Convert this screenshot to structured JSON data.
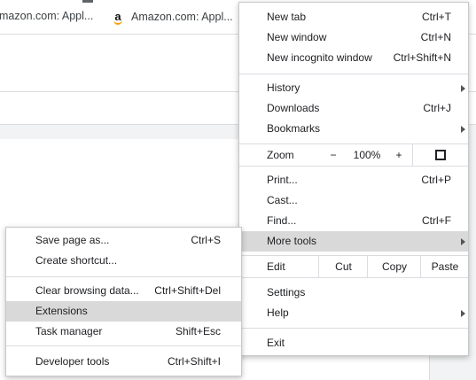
{
  "bookmarks": [
    {
      "label": "mazon.com: Appl...",
      "icon": "amazon-icon"
    },
    {
      "label": "Amazon.com: Appl...",
      "icon": "amazon-icon"
    }
  ],
  "main_menu": {
    "new_tab": {
      "label": "New tab",
      "shortcut": "Ctrl+T"
    },
    "new_window": {
      "label": "New window",
      "shortcut": "Ctrl+N"
    },
    "new_incognito": {
      "label": "New incognito window",
      "shortcut": "Ctrl+Shift+N"
    },
    "history": {
      "label": "History"
    },
    "downloads": {
      "label": "Downloads",
      "shortcut": "Ctrl+J"
    },
    "bookmarks": {
      "label": "Bookmarks"
    },
    "zoom": {
      "label": "Zoom",
      "minus": "−",
      "value": "100%",
      "plus": "+"
    },
    "print": {
      "label": "Print...",
      "shortcut": "Ctrl+P"
    },
    "cast": {
      "label": "Cast..."
    },
    "find": {
      "label": "Find...",
      "shortcut": "Ctrl+F"
    },
    "more_tools": {
      "label": "More tools"
    },
    "edit": {
      "label": "Edit",
      "cut": "Cut",
      "copy": "Copy",
      "paste": "Paste"
    },
    "settings": {
      "label": "Settings"
    },
    "help": {
      "label": "Help"
    },
    "exit": {
      "label": "Exit"
    }
  },
  "sub_menu": {
    "save_page": {
      "label": "Save page as...",
      "shortcut": "Ctrl+S"
    },
    "create_shortcut": {
      "label": "Create shortcut..."
    },
    "clear_browsing": {
      "label": "Clear browsing data...",
      "shortcut": "Ctrl+Shift+Del"
    },
    "extensions": {
      "label": "Extensions"
    },
    "task_manager": {
      "label": "Task manager",
      "shortcut": "Shift+Esc"
    },
    "developer_tools": {
      "label": "Developer tools",
      "shortcut": "Ctrl+Shift+I"
    }
  }
}
